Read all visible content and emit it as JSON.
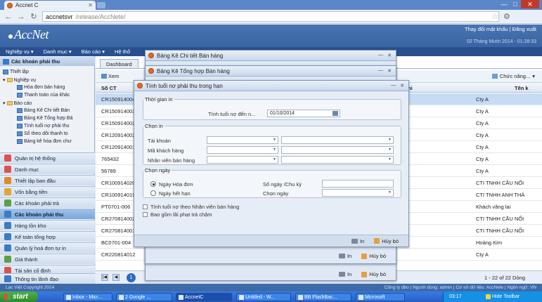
{
  "browser": {
    "tab_title": "Accnet C",
    "tab_close": "✕",
    "url_host": "accnetsvr",
    "url_path": "/release/AccNete/",
    "win_min": "—",
    "win_max": "□",
    "win_close": "✕"
  },
  "app": {
    "logo": "AccNet",
    "header_links": "Thay đổi mật khẩu | Đăng xuất",
    "header_date": "02 Tháng Mười 2014 - 01:28:33",
    "menu": [
      "Nghiệp vụ ▾",
      "Danh mục ▾",
      "Báo cáo ▾",
      "Hệ thố"
    ]
  },
  "sidebar": {
    "header": "Các khoản phải thu",
    "tree": [
      "Thiết lập",
      "Nghiệp vụ",
      "Hóa đơn bán hàng",
      "Thanh toán của khác",
      "Báo cáo",
      "Bảng Kê Chi tiết Bán",
      "Bảng Kê Tổng hợp Bá",
      "Tính tuổi nợ phải thu",
      "Sổ theo dõi thanh to",
      "Bảng kê hóa đơn chư"
    ],
    "sections": [
      {
        "label": "Quản trị hệ thống",
        "color": "#d9534f"
      },
      {
        "label": "Danh mục",
        "color": "#d9534f"
      },
      {
        "label": "Thiết lập ban đầu",
        "color": "#e08a2c"
      },
      {
        "label": "Vốn bằng tiền",
        "color": "#e0a92c"
      },
      {
        "label": "Các khoản phải trả",
        "color": "#5aa04a"
      },
      {
        "label": "Các khoản phải thu",
        "color": "#3b7cc4"
      },
      {
        "label": "Hàng tồn kho",
        "color": "#3b7cc4"
      },
      {
        "label": "Kế toán tổng hợp",
        "color": "#3b7cc4"
      },
      {
        "label": "Quản lý hoá đơn tự in",
        "color": "#3b7cc4"
      },
      {
        "label": "Giá thành",
        "color": "#5aa04a"
      },
      {
        "label": "Tài sản cố định",
        "color": "#d9534f"
      },
      {
        "label": "Thông tin lãnh đạo",
        "color": "#3b7cc4"
      }
    ]
  },
  "content": {
    "tab": "Dashboard",
    "toolbar_xem": "Xem",
    "chuc_nang": "Chức năng...",
    "col_so_ct": "Số CT",
    "col_ten_kh": "Tên k",
    "col_hi": "hi",
    "rows": [
      {
        "so_ct": "CR150914004",
        "ten": "Cty A"
      },
      {
        "so_ct": "CR150914003",
        "ten": "Cty A"
      },
      {
        "so_ct": "CR150914002",
        "ten": "Cty A"
      },
      {
        "so_ct": "CR120914002",
        "ten": "Cty A"
      },
      {
        "so_ct": "CR120914001",
        "ten": "Cty A"
      },
      {
        "so_ct": "765432",
        "ten": "Cty A"
      },
      {
        "so_ct": "56789",
        "ten": "Cty A"
      },
      {
        "so_ct": "CR100914020",
        "ten": "CTI TNHH CẦU NỐI"
      },
      {
        "so_ct": "CR100914019",
        "ten": "CTI TNHH ANH THÁ"
      },
      {
        "so_ct": "PT0701-006",
        "ten": "Khách vãng lai"
      },
      {
        "so_ct": "CR270814002",
        "ten": "CTI TNHH CẦU NỐI"
      },
      {
        "so_ct": "CR270814001",
        "ten": "CTI TNHH CẦU NỐI"
      },
      {
        "so_ct": "BC0701-004",
        "ten": "Hoàng Kim"
      },
      {
        "so_ct": "CR220814012",
        "ten": "Cty A"
      }
    ],
    "pager_page": "1",
    "pager_count": "1 - 22 of 22 Dòng"
  },
  "footer": {
    "left": "Lạc Việt Copyright 2014",
    "right": "Công ty dbo | Người dùng: admin | Cơ sở dữ liệu: AccNete | Ngôn ngữ: VN"
  },
  "win_chitiet": {
    "title": "Bảng Kê Chi tiết Bán hàng",
    "in": "In",
    "huy": "Hủy bỏ"
  },
  "win_tonghop": {
    "title": "Bảng Kê Tổng hợp Bán hàng",
    "in": "In",
    "huy": "Hủy bỏ"
  },
  "dialog": {
    "title": "Tính tuổi nợ phải thu trong hạn",
    "fs_time": "Thời gian in",
    "lbl_date": "Tính tuổi nợ đến n...",
    "date_value": "01/10/2014",
    "fs_chon_in": "Chọn in",
    "lbl_tk": "Tài khoản",
    "lbl_mkh": "Mã khách hàng",
    "lbl_nv": "Nhân viên bán hàng",
    "fs_chon_ngay": "Chọn ngày",
    "radio1": "Ngày Hóa đơn",
    "radio2": "Ngày hết hạn",
    "lbl_songay": "Số ngày /Chu kỳ",
    "lbl_chonngay": "Chọn ngày",
    "chk1": "Tính tuổi nợ theo Nhân viên bán hàng",
    "chk2": "Bao gồm lãi phạt trả chậm",
    "btn_in": "In",
    "btn_huy": "Hủy bỏ"
  },
  "taskbar": {
    "start": "start",
    "items": [
      {
        "label": "Inbox - Micr..."
      },
      {
        "label": "2 Google ..."
      },
      {
        "label": "AccnetC"
      },
      {
        "label": "Untitled - W..."
      },
      {
        "label": "BB FlashBac..."
      },
      {
        "label": "Microsoft"
      }
    ],
    "clock": "03:17",
    "hide": "Hide Toolbar"
  }
}
